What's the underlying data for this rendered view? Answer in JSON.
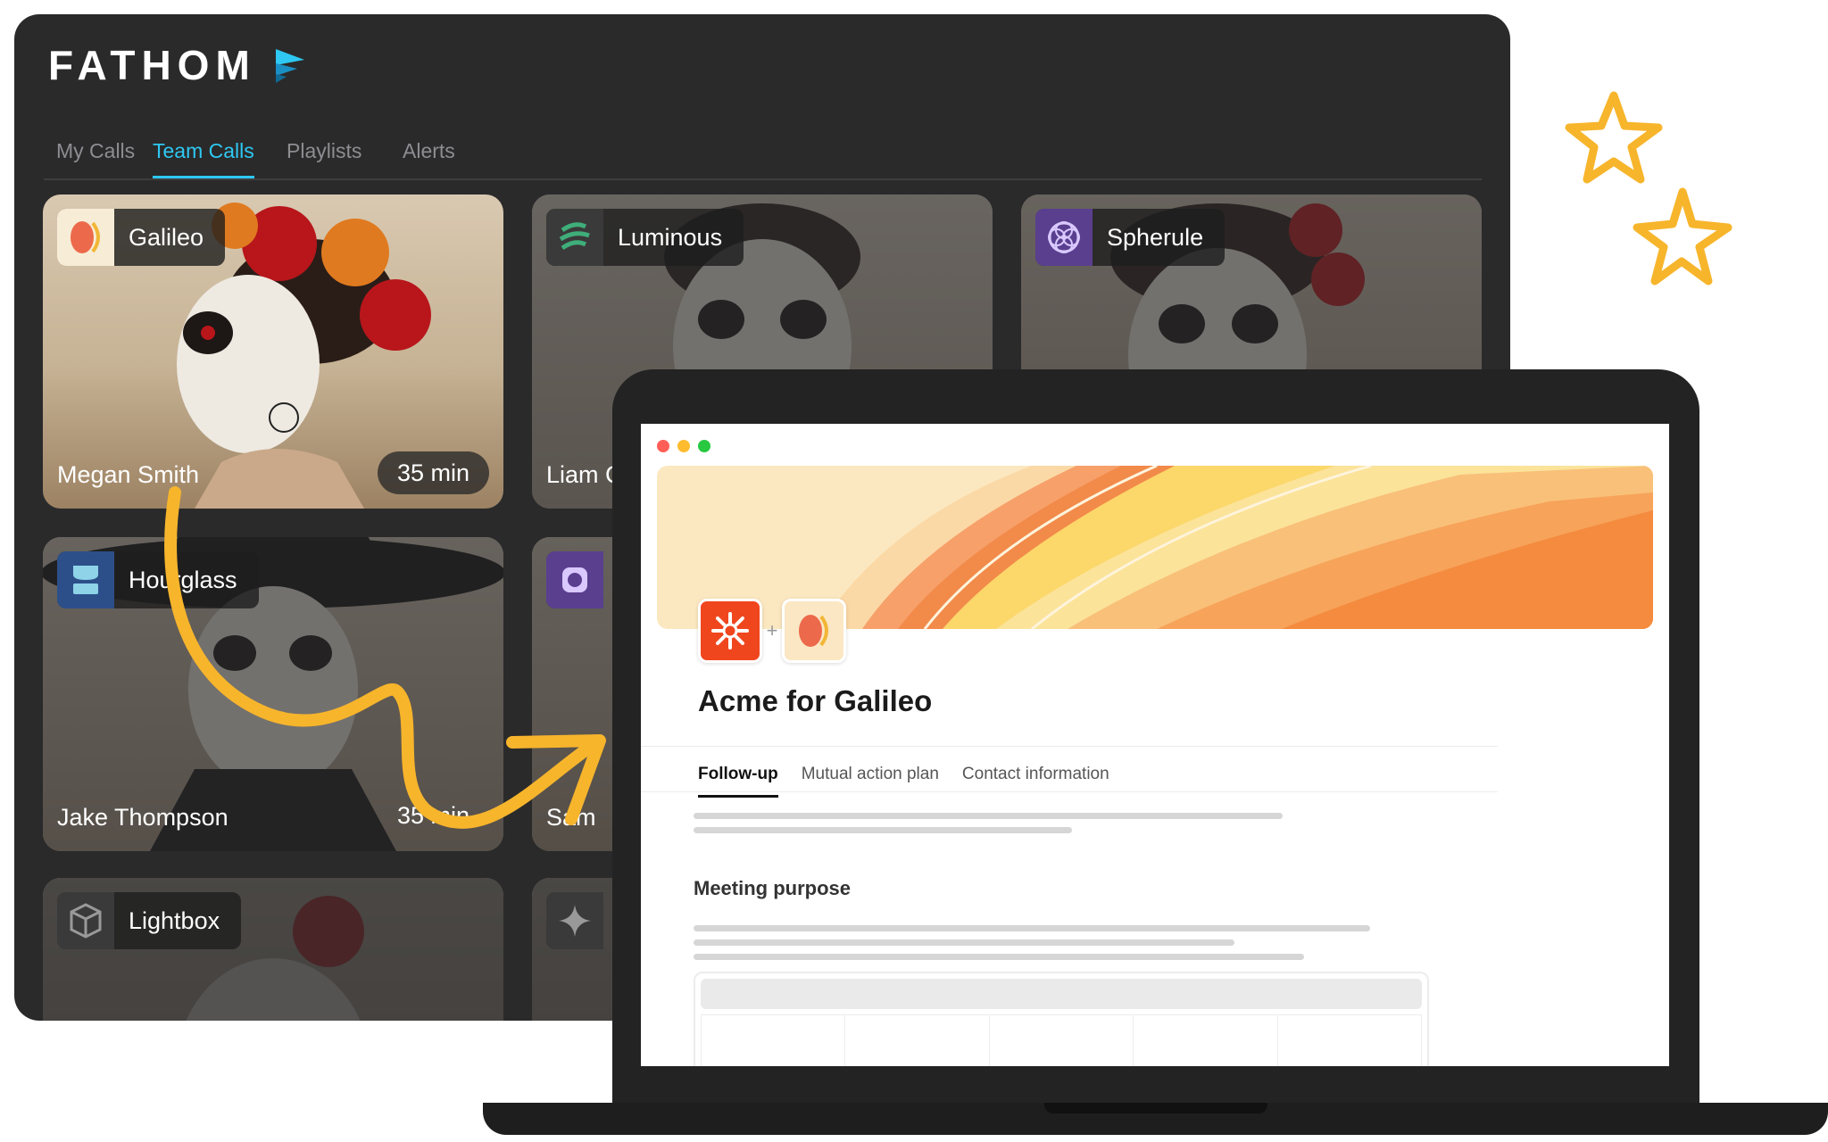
{
  "fathom": {
    "logo_text": "FATHOM",
    "nav": [
      "My Calls",
      "Team Calls",
      "Playlists",
      "Alerts"
    ],
    "active_tab": "Team Calls",
    "cards": [
      {
        "company": "Galileo",
        "person": "Megan Smith",
        "duration": "35 min"
      },
      {
        "company": "Luminous",
        "person": "Liam C"
      },
      {
        "company": "Spherule"
      },
      {
        "company": "Hourglass",
        "person": "Jake Thompson",
        "duration": "35 min"
      },
      {
        "person": "Sam"
      },
      {
        "company": "Lightbox"
      }
    ]
  },
  "workspace": {
    "title": "Acme for Galileo",
    "tabs": [
      "Follow-up",
      "Mutual action plan",
      "Contact information"
    ],
    "active_tab": "Follow-up",
    "section_heading": "Meeting purpose"
  },
  "colors": {
    "accent_blue": "#2ec8f2",
    "arrow_yellow": "#f7b52c",
    "window_dark": "#2a2a2b",
    "acme_red": "#f0461e"
  },
  "icons": [
    "fathom-logo-icon",
    "galileo-logo-icon",
    "luminous-logo-icon",
    "spherule-logo-icon",
    "hourglass-logo-icon",
    "lightbox-logo-icon",
    "sparkle-icon",
    "acme-logo-icon",
    "star-icon"
  ]
}
